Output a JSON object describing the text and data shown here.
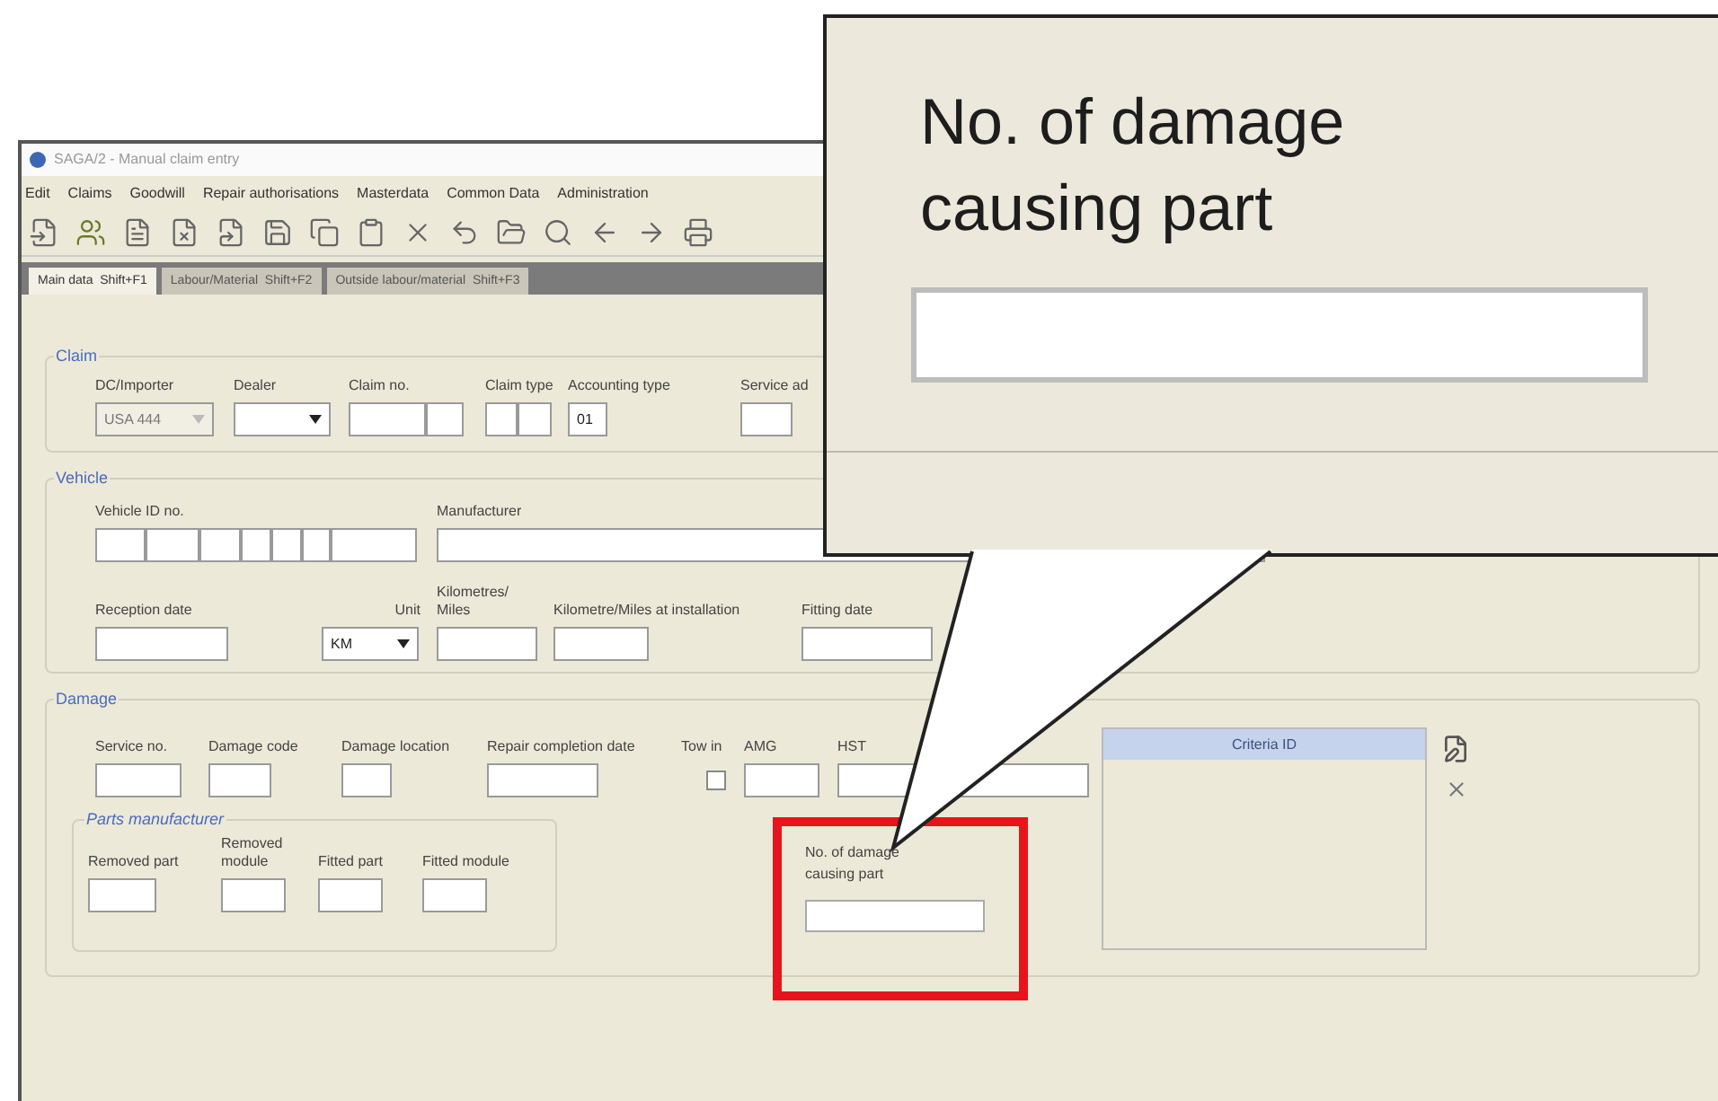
{
  "window": {
    "title": "SAGA/2 - Manual claim entry"
  },
  "menu": [
    {
      "label": "Edit"
    },
    {
      "label": "Claims"
    },
    {
      "label": "Goodwill"
    },
    {
      "label": "Repair authorisations"
    },
    {
      "label": "Masterdata"
    },
    {
      "label": "Common Data"
    },
    {
      "label": "Administration"
    }
  ],
  "tabs": [
    {
      "label": "Main data  Shift+F1",
      "selected": true
    },
    {
      "label": "Labour/Material  Shift+F2",
      "selected": false
    },
    {
      "label": "Outside labour/material  Shift+F3",
      "selected": false
    }
  ],
  "claim": {
    "title": "Claim",
    "fields": [
      {
        "label": "DC/Importer",
        "kind": "combo",
        "value": "USA 444",
        "disabled": true
      },
      {
        "label": "Dealer",
        "kind": "combo",
        "disabled": false
      },
      {
        "label": "Claim no.",
        "kind": "split"
      },
      {
        "label": "Claim type",
        "kind": "split"
      },
      {
        "label": "Accounting type",
        "kind": "text",
        "value": "01"
      },
      {
        "label": "Service ad",
        "kind": "text"
      }
    ]
  },
  "vehicle": {
    "title": "Vehicle",
    "fields": [
      {
        "label": "Vehicle ID no.",
        "kind": "split"
      },
      {
        "label": "Manufacturer",
        "kind": "text"
      },
      {
        "label": "Reception date",
        "kind": "text"
      },
      {
        "label": "Unit",
        "kind": "combo",
        "value": "KM",
        "disabled": false
      },
      {
        "label": "Kilometres/ Miles",
        "kind": "text"
      },
      {
        "label": "Kilometre/Miles at installation",
        "kind": "text"
      },
      {
        "label": "Fitting date",
        "kind": "text"
      }
    ]
  },
  "damage": {
    "title": "Damage",
    "fields": [
      {
        "label": "Service no.",
        "kind": "text"
      },
      {
        "label": "Damage code",
        "kind": "text"
      },
      {
        "label": "Damage location",
        "kind": "text"
      },
      {
        "label": "Repair completion date",
        "kind": "text"
      },
      {
        "label": "Tow in",
        "kind": "checkbox",
        "checked": false
      },
      {
        "label": "AMG",
        "kind": "text"
      },
      {
        "label": "HST",
        "kind": "text"
      }
    ],
    "parts_manufacturer": {
      "title": "Parts manufacturer",
      "fields": [
        {
          "label": "Removed part",
          "kind": "text"
        },
        {
          "label": "Removed module",
          "kind": "text"
        },
        {
          "label": "Fitted part",
          "kind": "text"
        },
        {
          "label": "Fitted module",
          "kind": "text"
        }
      ]
    },
    "highlighted_field": {
      "label": "No. of damage causing part"
    },
    "criteria": {
      "header": "Criteria ID"
    }
  },
  "callout": {
    "label": "No. of damage causing part"
  }
}
